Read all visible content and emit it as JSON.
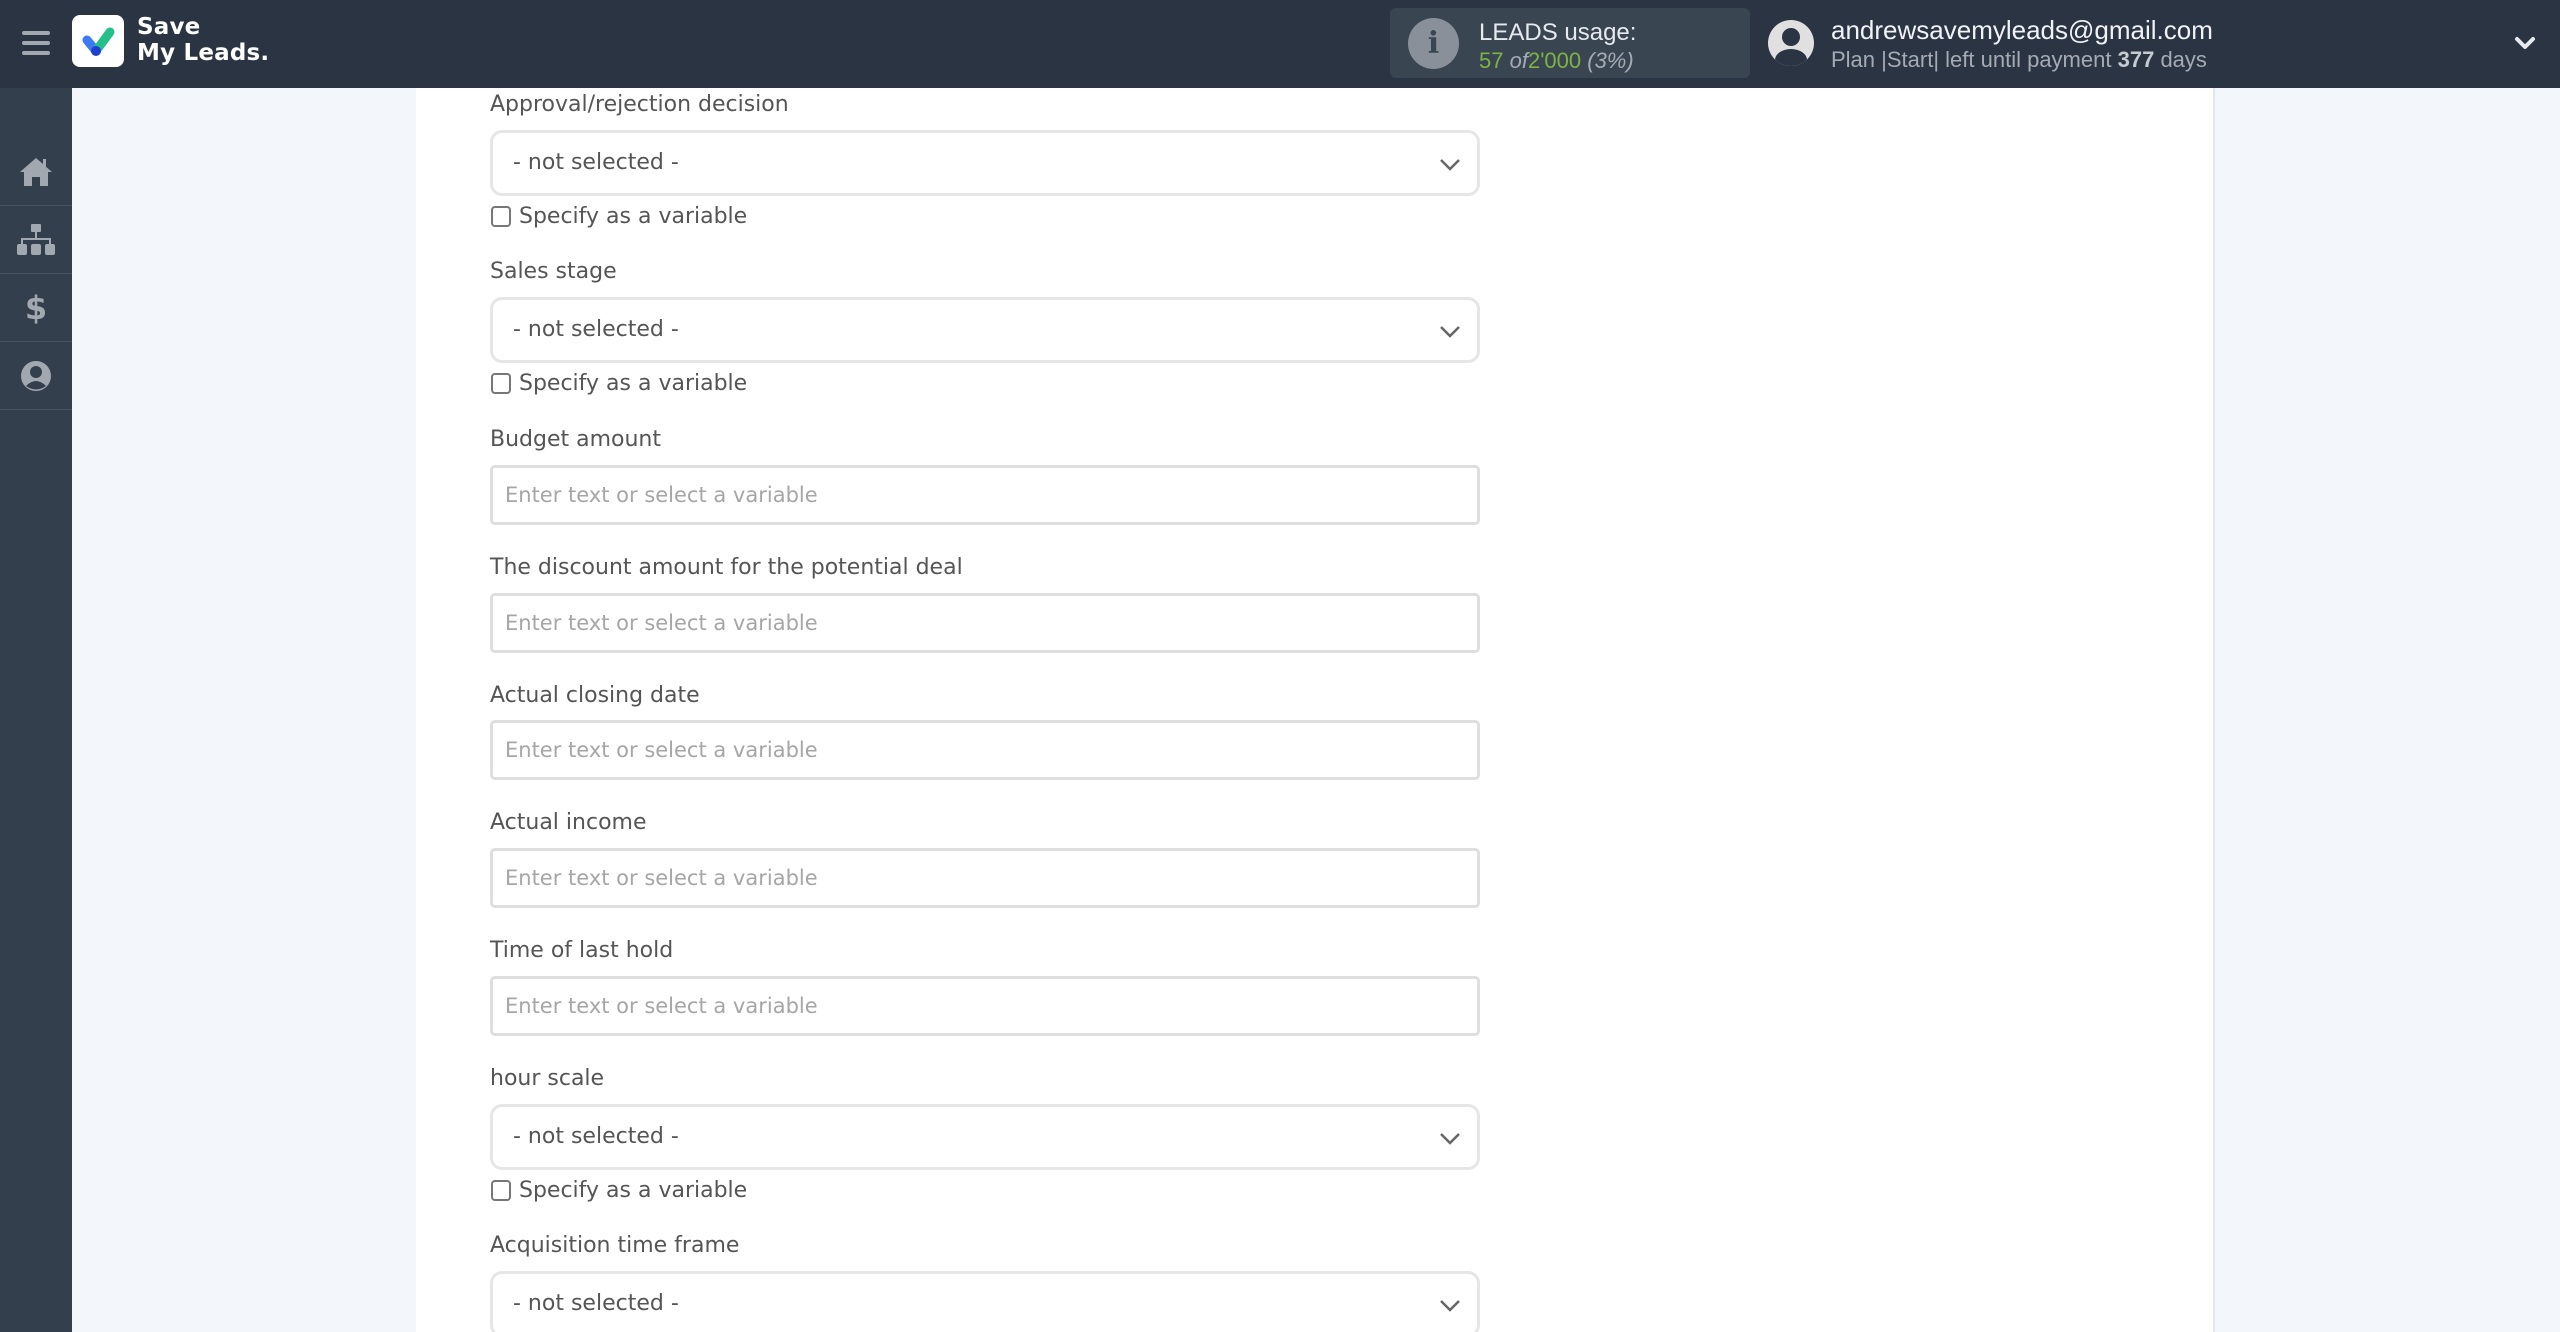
{
  "header": {
    "logo_line1": "Save",
    "logo_line2": "My Leads.",
    "leads_usage": {
      "title": "LEADS usage:",
      "used": "57",
      "of": "of",
      "limit": "2'000",
      "percent": "(3%)"
    },
    "user": {
      "email": "andrewsavemyleads@gmail.com",
      "plan_prefix": "Plan |Start| left until payment",
      "days": "377",
      "days_suffix": "days"
    }
  },
  "sidebar": {
    "items": [
      {
        "icon": "home-icon"
      },
      {
        "icon": "sitemap-icon"
      },
      {
        "icon": "dollar-icon"
      },
      {
        "icon": "user-circle-icon"
      }
    ]
  },
  "form": {
    "checkbox_label": "Specify as a variable",
    "input_placeholder": "Enter text or select a variable",
    "select_placeholder": "- not selected -",
    "fields": [
      {
        "label": "Approval/rejection decision",
        "type": "select",
        "value": "- not selected -",
        "has_checkbox": true
      },
      {
        "label": "Sales stage",
        "type": "select",
        "value": "- not selected -",
        "has_checkbox": true
      },
      {
        "label": "Budget amount",
        "type": "text",
        "value": ""
      },
      {
        "label": "The discount amount for the potential deal",
        "type": "text",
        "value": ""
      },
      {
        "label": "Actual closing date",
        "type": "text",
        "value": ""
      },
      {
        "label": "Actual income",
        "type": "text",
        "value": ""
      },
      {
        "label": "Time of last hold",
        "type": "text",
        "value": ""
      },
      {
        "label": "hour scale",
        "type": "select",
        "value": "- not selected -",
        "has_checkbox": true
      },
      {
        "label": "Acquisition time frame",
        "type": "select",
        "value": "- not selected -"
      }
    ]
  },
  "colors": {
    "header_bg": "#2a3443",
    "sidebar_bg": "#343f4d",
    "accent_green": "#7cb342",
    "page_bg": "#f3f6fb"
  }
}
